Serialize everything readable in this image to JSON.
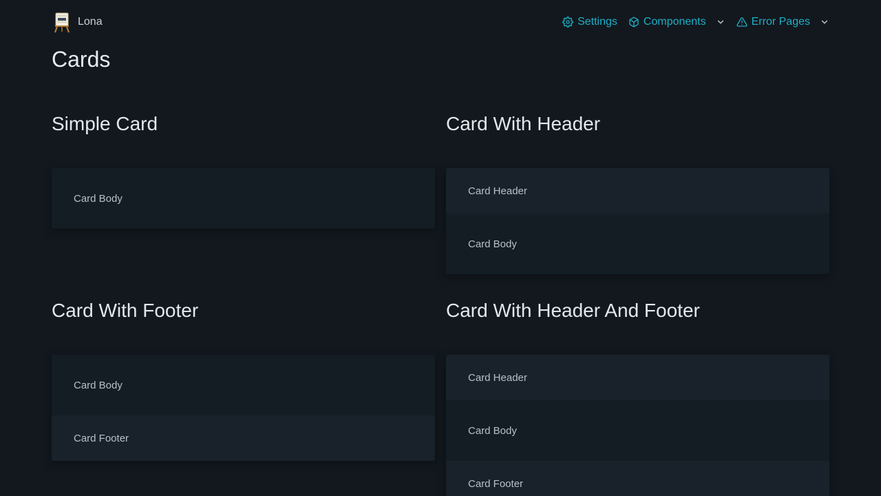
{
  "app": {
    "brand_name": "Lona"
  },
  "nav": {
    "settings": "Settings",
    "components": "Components",
    "error_pages": "Error Pages"
  },
  "page": {
    "title": "Cards"
  },
  "sections": {
    "simple": {
      "title": "Simple Card",
      "body": "Card Body"
    },
    "with_header": {
      "title": "Card With Header",
      "header": "Card Header",
      "body": "Card Body"
    },
    "with_footer": {
      "title": "Card With Footer",
      "body": "Card Body",
      "footer": "Card Footer"
    },
    "with_header_footer": {
      "title": "Card With Header And Footer",
      "header": "Card Header",
      "body": "Card Body",
      "footer": "Card Footer"
    }
  },
  "colors": {
    "background": "#12181e",
    "accent": "#1eb0c8",
    "card_body": "#141d24",
    "card_header_footer": "#19222a"
  },
  "icons": {
    "logo": "easel-logo-icon",
    "settings": "gear-icon",
    "components": "cube-icon",
    "error_pages": "warning-triangle-icon",
    "dropdown": "chevron-down-icon"
  }
}
